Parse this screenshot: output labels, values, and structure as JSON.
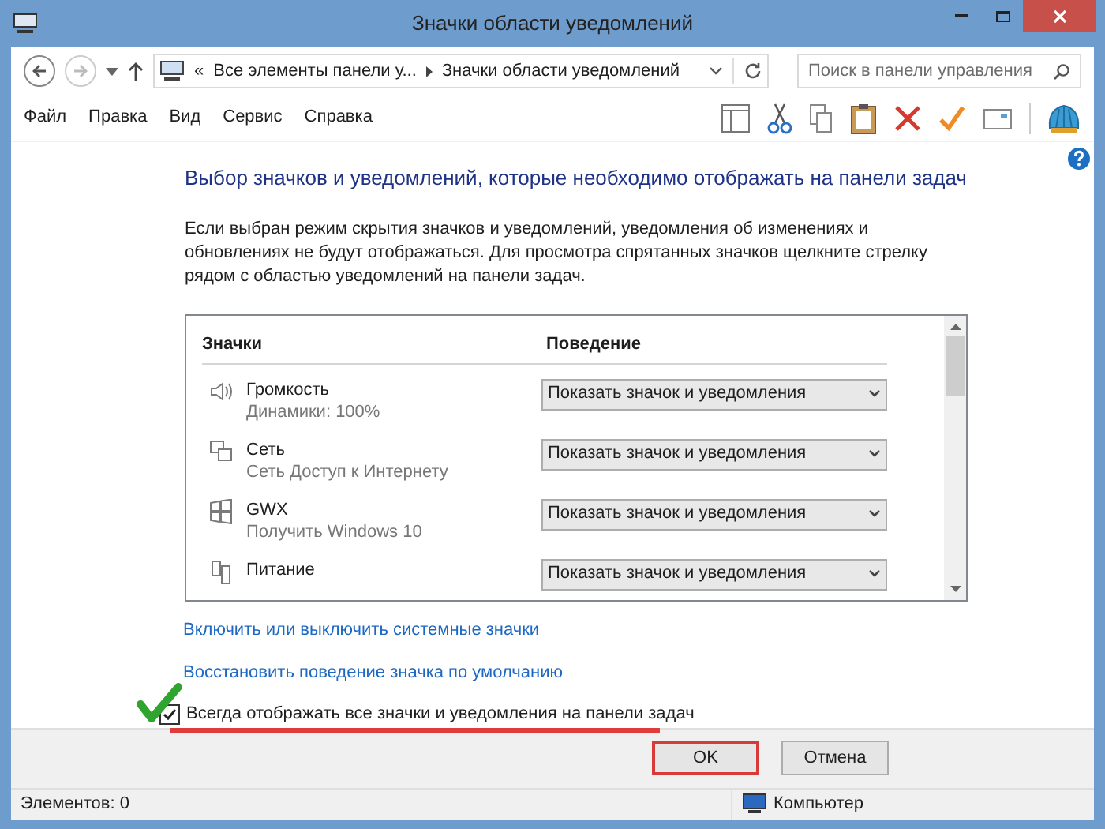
{
  "window": {
    "title": "Значки области уведомлений"
  },
  "address": {
    "path": [
      "«",
      "Все элементы панели у...",
      "Значки области уведомлений"
    ]
  },
  "search": {
    "placeholder": "Поиск в панели управления"
  },
  "menu": [
    "Файл",
    "Правка",
    "Вид",
    "Сервис",
    "Справка"
  ],
  "heading": "Выбор значков и уведомлений, которые необходимо отображать на панели задач",
  "description": "Если выбран режим скрытия значков и уведомлений, уведомления об изменениях и обновлениях не будут отображаться. Для просмотра спрятанных значков щелкните стрелку рядом с областью уведомлений на панели задач.",
  "table": {
    "columns": [
      "Значки",
      "Поведение"
    ],
    "rows": [
      {
        "kind": "speaker",
        "name": "Громкость",
        "detail": "Динамики: 100%",
        "behavior": "Показать значок и уведомления"
      },
      {
        "kind": "network",
        "name": "Сеть",
        "detail": "Сеть Доступ к Интернету",
        "behavior": "Показать значок и уведомления"
      },
      {
        "kind": "windows",
        "name": "GWX",
        "detail": "Получить Windows 10",
        "behavior": "Показать значок и уведомления"
      },
      {
        "kind": "power",
        "name": "Питание",
        "behavior": "Показать значок и уведомления"
      }
    ]
  },
  "links": [
    "Включить или выключить системные значки",
    "Восстановить поведение значка по умолчанию"
  ],
  "always_show": {
    "label": "Всегда отображать все значки и уведомления на панели задач",
    "checked": true
  },
  "buttons": [
    {
      "label": "OK",
      "selected": true
    },
    {
      "label": "Отмена",
      "selected": false
    }
  ],
  "status_bar": {
    "items": "Элементов: 0",
    "location": "Компьютер"
  }
}
